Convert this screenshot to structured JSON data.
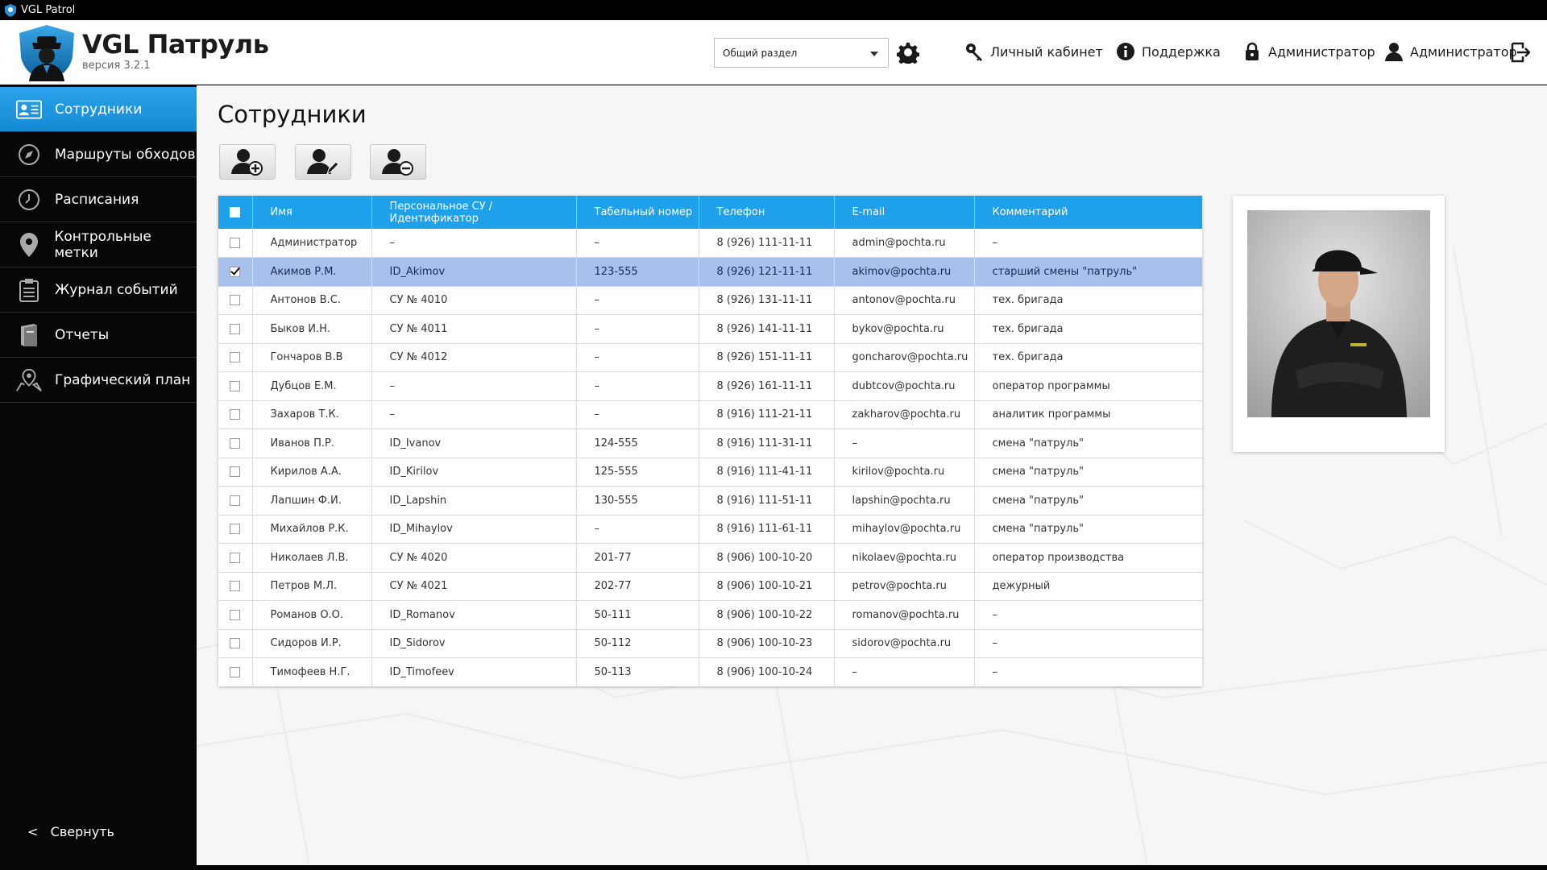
{
  "window": {
    "title": "VGL Patrol"
  },
  "app": {
    "title": "VGL Патруль",
    "version": "версия 3.2.1"
  },
  "header": {
    "section_select": "Общий раздел",
    "links": {
      "cabinet": "Личный кабинет",
      "support": "Поддержка",
      "admin_lock": "Администратор",
      "admin_user": "Администратор"
    }
  },
  "sidebar": {
    "items": [
      {
        "label": "Сотрудники",
        "icon": "employees-icon",
        "active": true
      },
      {
        "label": "Маршруты обходов",
        "icon": "compass-icon"
      },
      {
        "label": "Расписания",
        "icon": "clock-icon"
      },
      {
        "label": "Контрольные метки",
        "icon": "map-pin-icon"
      },
      {
        "label": "Журнал событий",
        "icon": "clipboard-icon"
      },
      {
        "label": "Отчеты",
        "icon": "book-icon"
      },
      {
        "label": "Графический план",
        "icon": "map-location-icon"
      }
    ],
    "collapse_arrow": "<",
    "collapse_label": "Свернуть"
  },
  "main": {
    "title": "Сотрудники",
    "toolbar": {
      "add": "add-user-icon",
      "edit": "edit-user-icon",
      "remove": "remove-user-icon"
    }
  },
  "table": {
    "columns": [
      "Имя",
      "Персональное СУ / Идентификатор",
      "Табельный номер",
      "Телефон",
      "E-mail",
      "Комментарий"
    ],
    "rows": [
      {
        "name": "Администратор",
        "id": "–",
        "tab": "–",
        "phone": "8 (926) 111-11-11",
        "email": "admin@pochta.ru",
        "comment": "–"
      },
      {
        "name": "Акимов Р.М.",
        "id": "ID_Akimov",
        "tab": "123-555",
        "phone": "8 (926) 121-11-11",
        "email": "akimov@pochta.ru",
        "comment": "старший смены \"патруль\"",
        "selected": true
      },
      {
        "name": "Антонов В.С.",
        "id": "СУ № 4010",
        "tab": "–",
        "phone": "8 (926) 131-11-11",
        "email": "antonov@pochta.ru",
        "comment": "тех. бригада"
      },
      {
        "name": "Быков И.Н.",
        "id": "СУ № 4011",
        "tab": "–",
        "phone": "8 (926) 141-11-11",
        "email": "bykov@pochta.ru",
        "comment": "тех. бригада"
      },
      {
        "name": "Гончаров В.В",
        "id": "СУ № 4012",
        "tab": "–",
        "phone": "8 (926) 151-11-11",
        "email": "goncharov@pochta.ru",
        "comment": "тех. бригада"
      },
      {
        "name": "Дубцов Е.М.",
        "id": "–",
        "tab": "–",
        "phone": "8 (926) 161-11-11",
        "email": "dubtcov@pochta.ru",
        "comment": "оператор программы"
      },
      {
        "name": "Захаров Т.К.",
        "id": "–",
        "tab": "–",
        "phone": "8 (916) 111-21-11",
        "email": "zakharov@pochta.ru",
        "comment": "аналитик программы"
      },
      {
        "name": "Иванов П.Р.",
        "id": "ID_Ivanov",
        "tab": "124-555",
        "phone": "8 (916) 111-31-11",
        "email": "–",
        "comment": "смена \"патруль\""
      },
      {
        "name": "Кирилов А.А.",
        "id": "ID_Kirilov",
        "tab": "125-555",
        "phone": "8 (916) 111-41-11",
        "email": "kirilov@pochta.ru",
        "comment": "смена \"патруль\""
      },
      {
        "name": "Лапшин Ф.И.",
        "id": "ID_Lapshin",
        "tab": "130-555",
        "phone": "8 (916) 111-51-11",
        "email": "lapshin@pochta.ru",
        "comment": "смена \"патруль\""
      },
      {
        "name": "Михайлов Р.К.",
        "id": "ID_Mihaylov",
        "tab": "–",
        "phone": "8 (916) 111-61-11",
        "email": "mihaylov@pochta.ru",
        "comment": "смена \"патруль\""
      },
      {
        "name": "Николаев Л.В.",
        "id": "СУ № 4020",
        "tab": "201-77",
        "phone": "8 (906) 100-10-20",
        "email": "nikolaev@pochta.ru",
        "comment": "оператор производства"
      },
      {
        "name": "Петров М.Л.",
        "id": "СУ № 4021",
        "tab": "202-77",
        "phone": "8 (906) 100-10-21",
        "email": "petrov@pochta.ru",
        "comment": "дежурный"
      },
      {
        "name": "Романов О.О.",
        "id": "ID_Romanov",
        "tab": "50-111",
        "phone": "8 (906) 100-10-22",
        "email": "romanov@pochta.ru",
        "comment": "–"
      },
      {
        "name": "Сидоров И.Р.",
        "id": "ID_Sidorov",
        "tab": "50-112",
        "phone": "8 (906) 100-10-23",
        "email": "sidorov@pochta.ru",
        "comment": "–"
      },
      {
        "name": "Тимофеев Н.Г.",
        "id": "ID_Timofeev",
        "tab": "50-113",
        "phone": "8 (906) 100-10-24",
        "email": "–",
        "comment": "–"
      }
    ]
  },
  "colors": {
    "accent": "#1ea0ea",
    "sidebar_bg": "#070707",
    "selected_row": "#a8c1ec"
  }
}
